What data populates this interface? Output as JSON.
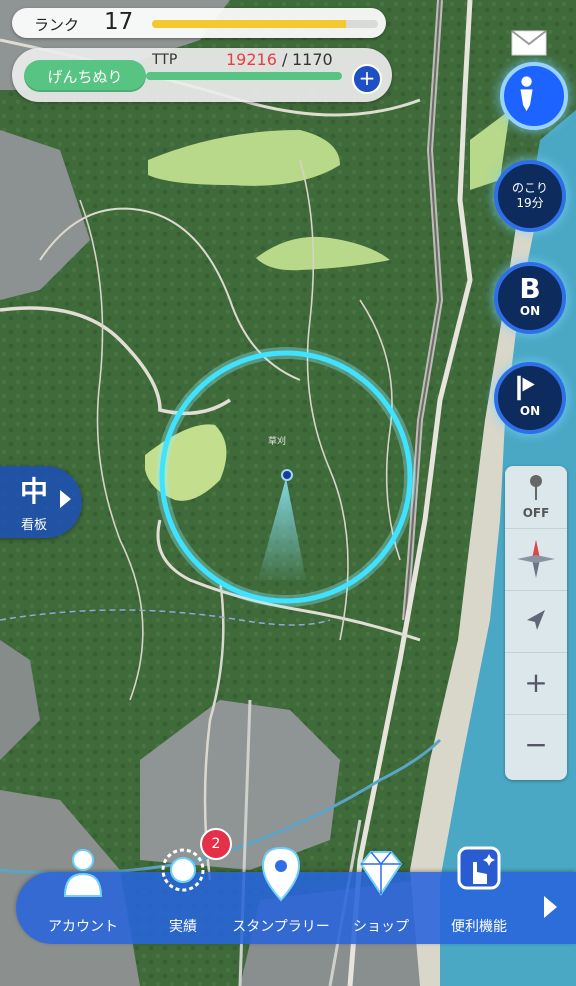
{
  "header": {
    "rank_label": "ランク",
    "rank_value": "17",
    "rank_progress": 0.86,
    "mode_button_label": "げんちぬり",
    "ttp_label": "TTP",
    "ttp_current": "19216",
    "ttp_separator": "/",
    "ttp_max": "1170",
    "plus_icon": "plus-icon"
  },
  "right_controls": {
    "mail_icon": "envelope-icon",
    "locate_icon": "person-pin-icon",
    "remaining_line1": "のこり",
    "remaining_line2": "19分",
    "b_label": "B",
    "b_state": "ON",
    "flag_state": "ON",
    "pin_off_label": "OFF",
    "compass_icon": "compass-icon",
    "direction_icon": "navigation-arrow-icon",
    "zoom_in": "+",
    "zoom_out": "−"
  },
  "billboard": {
    "kanji": "中",
    "label": "看板"
  },
  "map": {
    "place_label": "草刈"
  },
  "bottom_nav": {
    "items": [
      {
        "label": "アカウント",
        "icon": "person-icon"
      },
      {
        "label": "実績",
        "icon": "medal-icon"
      },
      {
        "label": "スタンプラリー",
        "icon": "map-pin-icon"
      },
      {
        "label": "ショップ",
        "icon": "diamond-icon"
      },
      {
        "label": "便利機能",
        "icon": "tap-sparkle-icon"
      }
    ],
    "achievements_badge": "2",
    "more_icon": "chevron-right-icon"
  },
  "colors": {
    "primary_blue": "#2e6fe8",
    "mode_green": "#57c483",
    "ttp_red": "#e83e3e",
    "rank_yellow": "#f3c92d",
    "badge_red": "#e5304a"
  }
}
